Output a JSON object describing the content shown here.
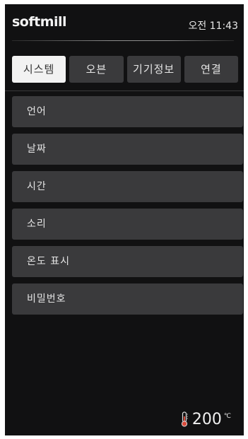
{
  "status": {
    "brand": "softmill",
    "time": "오전 11:43"
  },
  "tabs": [
    {
      "label": "시스템",
      "active": true
    },
    {
      "label": "오븐",
      "active": false
    },
    {
      "label": "기기정보",
      "active": false
    },
    {
      "label": "연결",
      "active": false
    }
  ],
  "menu": {
    "items": [
      {
        "label": "언어"
      },
      {
        "label": "날짜"
      },
      {
        "label": "시간"
      },
      {
        "label": "소리"
      },
      {
        "label": "온도 표시"
      },
      {
        "label": "비밀번호"
      }
    ]
  },
  "temperature": {
    "value": "200",
    "unit": "℃",
    "icon": "thermometer-icon"
  },
  "colors": {
    "background": "#111112",
    "tab_active": "#f2f2f2",
    "item": "#3a3a3c",
    "temp_icon": "#d84a3a"
  }
}
